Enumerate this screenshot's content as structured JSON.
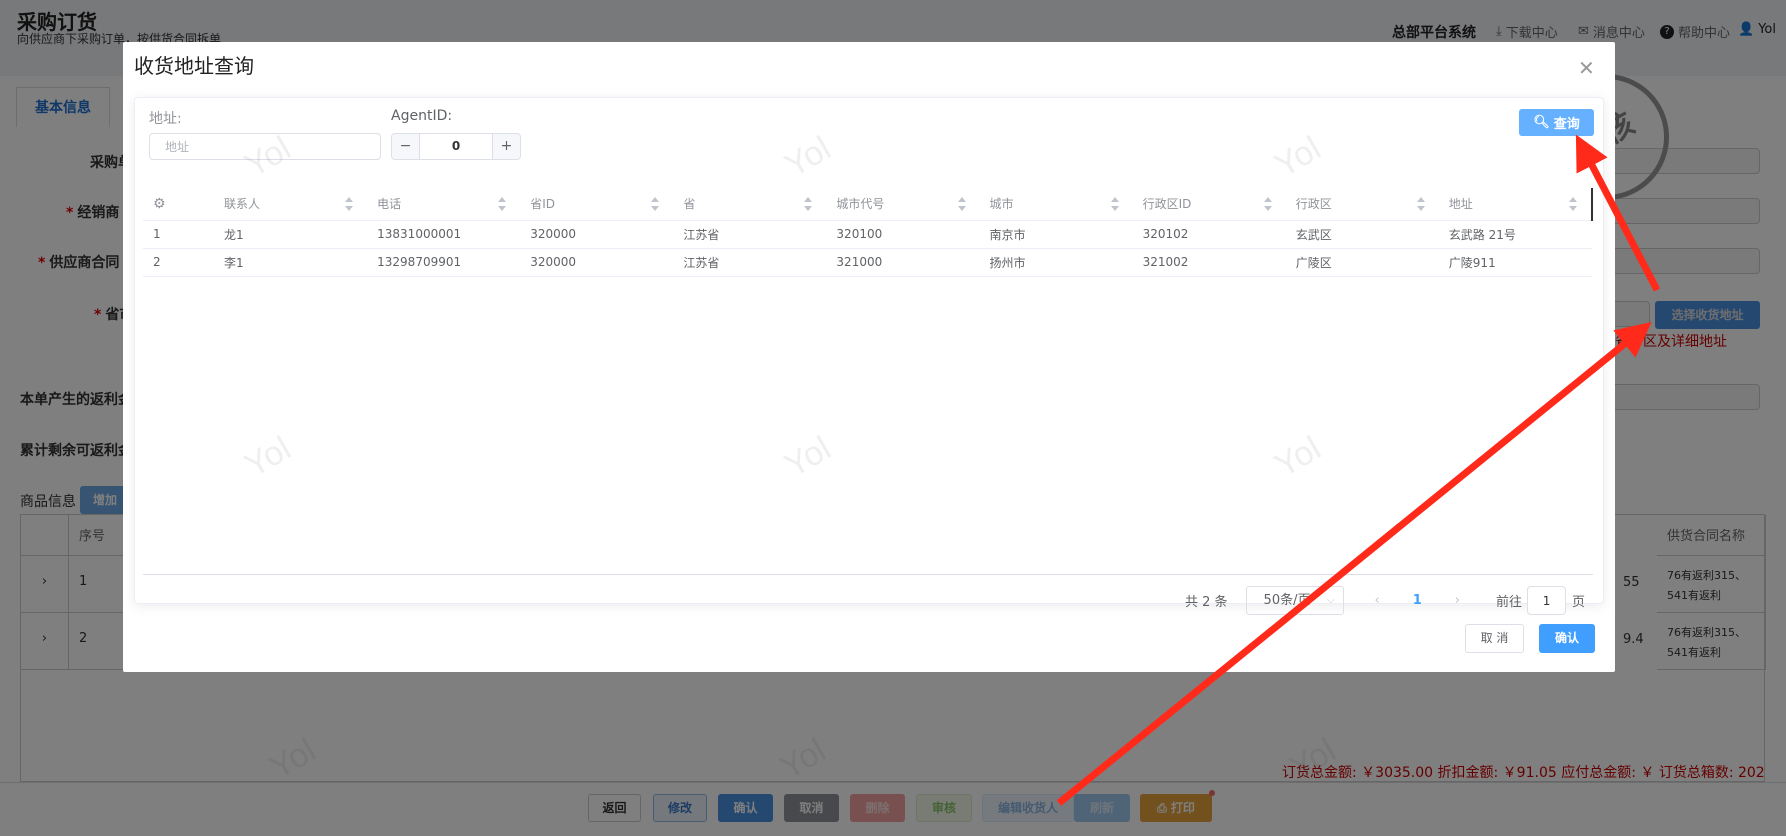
{
  "page": {
    "title": "采购订货",
    "subtitle": "向供应商下采购订单，按供货合同拆单",
    "system_name": "总部平台系统",
    "nav": {
      "download": "下载中心",
      "messages": "消息中心",
      "help": "帮助中心",
      "user": "Yol"
    },
    "tab_basic": "基本信息",
    "form_labels": [
      "采购单",
      "经销商",
      "供应商合同",
      "省市",
      "本单产生的返利金",
      "累计剩余可返利金"
    ],
    "select_address_button": "选择收货地址",
    "address_hint": "省市区及详细地址",
    "stamp": "审核",
    "goods_label": "商品信息",
    "add_button": "增加",
    "goods_table": {
      "headers": [
        "序号",
        "供货合同名称"
      ],
      "rows": [
        {
          "index": "1",
          "partial_value": "55",
          "contract": "76有返利315、541有返利"
        },
        {
          "index": "2",
          "partial_value": "9.4",
          "contract": "76有返利315、541有返利"
        }
      ]
    },
    "totals": "订货总金额: ￥3035.00   折扣金额: ￥91.05   应付总金额: ￥   订货总箱数: 202",
    "bottom_buttons": {
      "back": "返回",
      "edit": "修改",
      "confirm": "确认",
      "cancel": "取消",
      "delete": "删除",
      "audit": "审核",
      "edit_receiver": "编辑收货人",
      "refresh": "刷新",
      "print": "打印"
    },
    "watermark": "Yol"
  },
  "modal": {
    "title": "收货地址查询",
    "address_label": "地址:",
    "address_placeholder": "地址",
    "address_value": "",
    "agent_label": "AgentID:",
    "agent_value": "0",
    "query_button": "查询",
    "columns": [
      "联系人",
      "电话",
      "省ID",
      "省",
      "城市代号",
      "城市",
      "行政区ID",
      "行政区",
      "地址"
    ],
    "rows": [
      [
        "1",
        "龙1",
        "13831000001",
        "320000",
        "江苏省",
        "320100",
        "南京市",
        "320102",
        "玄武区",
        "玄武路 21号"
      ],
      [
        "2",
        "李1",
        "13298709901",
        "320000",
        "江苏省",
        "321000",
        "扬州市",
        "321002",
        "广陵区",
        "广陵911"
      ]
    ],
    "pagination": {
      "total": "共 2 条",
      "page_size": "50条/页",
      "current_page": "1",
      "goto_label": "前往",
      "goto_value": "1",
      "page_suffix": "页"
    },
    "cancel_button": "取 消",
    "confirm_button": "确认"
  },
  "colors": {
    "primary": "#409eff",
    "annotation_arrow": "#ff2a1a",
    "totals": "#cc0000"
  }
}
